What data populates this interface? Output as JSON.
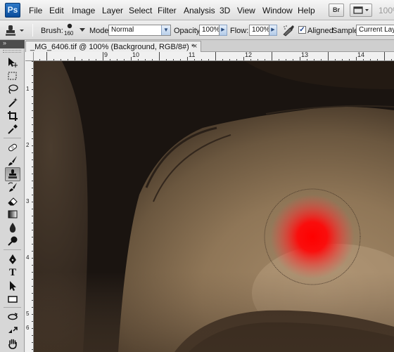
{
  "app": {
    "logo_text": "Ps",
    "zoom_hint": "100%"
  },
  "menu": [
    "File",
    "Edit",
    "Image",
    "Layer",
    "Select",
    "Filter",
    "Analysis",
    "3D",
    "View",
    "Window",
    "Help"
  ],
  "menubar_buttons": {
    "bridge": "Br"
  },
  "options": {
    "brush_label": "Brush:",
    "brush_size": "160",
    "mode_label": "Mode:",
    "mode_value": "Normal",
    "opacity_label": "Opacity:",
    "opacity_value": "100%",
    "flow_label": "Flow:",
    "flow_value": "100%",
    "aligned_label": "Aligned",
    "aligned_checked": true,
    "sample_label": "Sample:",
    "sample_value": "Current Layer"
  },
  "document": {
    "tab_title": "_MG_6406.tif @ 100% (Background, RGB/8#) *",
    "close_glyph": "×"
  },
  "ruler": {
    "horizontal": [
      "9",
      "10",
      "11",
      "12",
      "13",
      "14"
    ],
    "vertical": [
      "1",
      "2",
      "3",
      "4",
      "5",
      "6"
    ]
  },
  "tools": [
    "move-tool",
    "marquee-tool",
    "lasso-tool",
    "quick-selection-tool",
    "crop-tool",
    "eyedropper-tool",
    "healing-brush-tool",
    "brush-tool",
    "clone-stamp-tool",
    "history-brush-tool",
    "eraser-tool",
    "gradient-tool",
    "blur-tool",
    "dodge-tool",
    "pen-tool",
    "type-tool",
    "path-selection-tool",
    "rectangle-tool",
    "3d-rotate-tool",
    "3d-orbit-tool",
    "hand-tool"
  ],
  "active_tool": "clone-stamp-tool",
  "colors": {
    "brush_preview": "#ff0000",
    "skin": "#8f7657",
    "hair": "#1a1410"
  }
}
